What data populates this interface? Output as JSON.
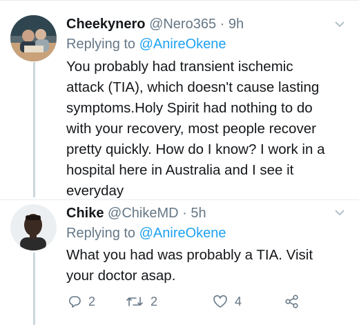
{
  "tweets": [
    {
      "name": "Cheekynero",
      "handle": "@Nero365",
      "time": "· 9h",
      "replying_prefix": "Replying to",
      "replying_to": "@AnireOkene",
      "text_lines": [
        "You probably had transient ischemic",
        "attack (TIA), which doesn't cause lasting",
        "symptoms.Holy Spirit had nothing to do",
        "with your recovery, most people recover",
        "pretty quickly. How do I know? I work in a",
        "hospital here in Australia and I see it",
        "everyday"
      ]
    },
    {
      "name": "Chike",
      "handle": "@ChikeMD",
      "time": "· 5h",
      "replying_prefix": "Replying to",
      "replying_to": "@AnireOkene",
      "text_lines": [
        "What you had was probably a TIA. Visit",
        "your doctor asap."
      ],
      "actions": {
        "replies": "2",
        "retweets": "2",
        "likes": "4"
      }
    }
  ],
  "colors": {
    "text": "#14171a",
    "muted": "#657786",
    "link": "#1da1f2",
    "line": "#ccd6dd"
  },
  "icons": {
    "chevron": "chevron-down-icon",
    "reply": "reply-icon",
    "retweet": "retweet-icon",
    "like": "heart-icon",
    "share": "share-icon"
  }
}
